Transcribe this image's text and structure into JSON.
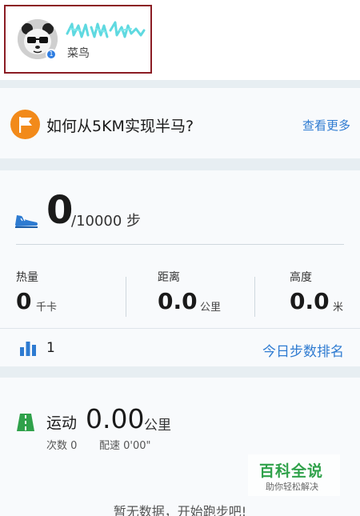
{
  "profile": {
    "level_label": "菜鸟",
    "level_badge": "1"
  },
  "tip": {
    "title": "如何从5KM实现半马?",
    "more_label": "查看更多"
  },
  "steps": {
    "current": "0",
    "goal": "/10000 步"
  },
  "stats": {
    "calories": {
      "label": "热量",
      "value": "0",
      "unit": "千卡"
    },
    "distance": {
      "label": "距离",
      "value": "0.0",
      "unit": "公里"
    },
    "altitude": {
      "label": "高度",
      "value": "0.0",
      "unit": "米"
    }
  },
  "ranking": {
    "value": "1",
    "link_label": "今日步数排名"
  },
  "sport": {
    "label": "运动",
    "value": "0.00",
    "unit": "公里",
    "count_text": "次数 0",
    "pace_text": "配速 0'00\"",
    "empty_text": "暂无数据，开始跑步吧!"
  },
  "watermark": {
    "main": "百科全说",
    "sub": "助你轻松解决"
  },
  "colors": {
    "accent_blue": "#2e7bd1",
    "flag_orange": "#f28a1a",
    "road_green": "#2fa14a",
    "highlight_red": "#8b1d24"
  },
  "icons": [
    "flag-icon",
    "shoe-icon",
    "bar-chart-icon",
    "road-icon"
  ]
}
